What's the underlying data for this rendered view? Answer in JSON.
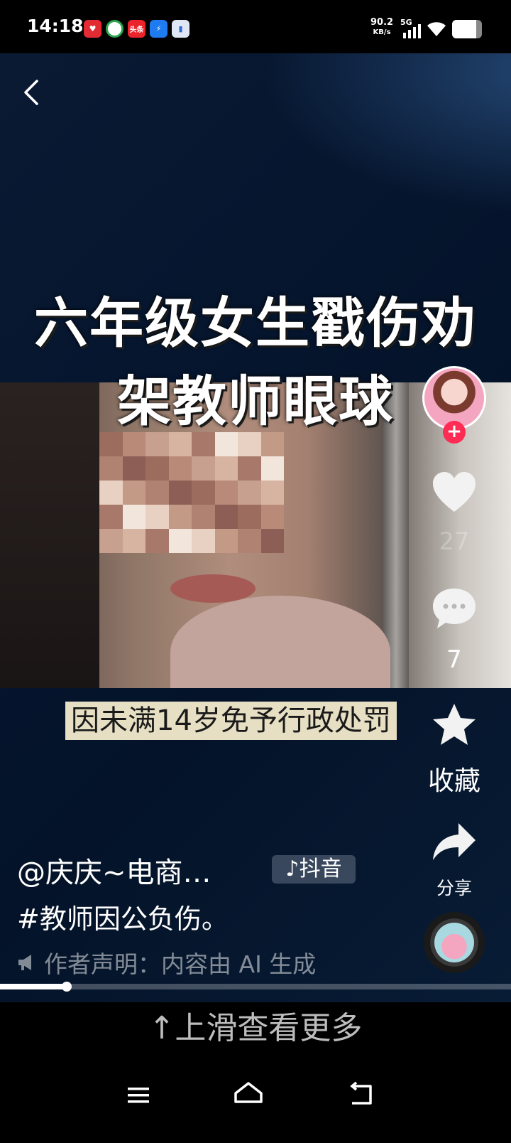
{
  "status_bar": {
    "time": "14:18",
    "net_speed": "90.2",
    "net_unit": "KB/s",
    "network": "5G",
    "notification_icons": [
      "pinduoduo-icon",
      "recycle-icon",
      "toutiao-icon",
      "bolt-app-icon",
      "doc-app-icon"
    ],
    "toutiao_label": "头条",
    "battery_level": 0.8
  },
  "video": {
    "title_line1": "六年级女生戳伤劝",
    "title_line2": "架教师眼球",
    "caption": "因未满14岁免予行政处罚"
  },
  "rail": {
    "likes": "27",
    "comments": "7",
    "favorite_label": "收藏",
    "share_label": "分享",
    "follow_symbol": "+"
  },
  "info": {
    "author": "@庆庆~电商…",
    "badge": "抖音",
    "hashtag": "#教师因公负伤。",
    "declaration": "作者声明：内容由 AI 生成"
  },
  "progress": 0.13,
  "swipe_hint": "↑上滑查看更多",
  "colors": {
    "accent": "#fe2c55",
    "background": "#06162f",
    "caption_bg": "#e7dfc3"
  }
}
